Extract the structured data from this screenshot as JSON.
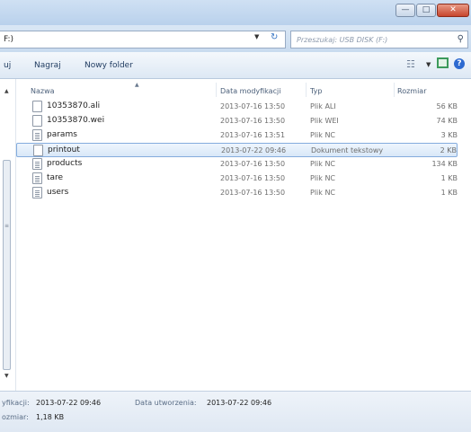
{
  "window": {
    "minimize_glyph": "—",
    "maximize_glyph": "□",
    "close_glyph": "✕"
  },
  "address": {
    "path_fragment": "F:)",
    "search_placeholder": "Przeszukaj: USB DISK (F:)"
  },
  "toolbar": {
    "organize_fragment": "uj",
    "burn_label": "Nagraj",
    "new_folder_label": "Nowy folder"
  },
  "columns": {
    "name": "Nazwa",
    "date": "Data modyfikacji",
    "type": "Typ",
    "size": "Rozmiar"
  },
  "files": [
    {
      "name": "10353870.ali",
      "date": "2013-07-16 13:50",
      "type": "Plik ALI",
      "size": "56 KB",
      "icon": "blank-file-icon"
    },
    {
      "name": "10353870.wei",
      "date": "2013-07-16 13:50",
      "type": "Plik WEI",
      "size": "74 KB",
      "icon": "blank-file-icon"
    },
    {
      "name": "params",
      "date": "2013-07-16 13:51",
      "type": "Plik NC",
      "size": "3 KB",
      "icon": "text-file-icon"
    },
    {
      "name": "printout",
      "date": "2013-07-22 09:46",
      "type": "Dokument tekstowy",
      "size": "2 KB",
      "icon": "blank-file-icon",
      "selected": true
    },
    {
      "name": "products",
      "date": "2013-07-16 13:50",
      "type": "Plik NC",
      "size": "134 KB",
      "icon": "text-file-icon"
    },
    {
      "name": "tare",
      "date": "2013-07-16 13:50",
      "type": "Plik NC",
      "size": "1 KB",
      "icon": "text-file-icon"
    },
    {
      "name": "users",
      "date": "2013-07-16 13:50",
      "type": "Plik NC",
      "size": "1 KB",
      "icon": "text-file-icon"
    }
  ],
  "details": {
    "modified_label": "yfikacji:",
    "modified_value": "2013-07-22 09:46",
    "created_label": "Data utworzenia:",
    "created_value": "2013-07-22 09:46",
    "size_label": "ozmiar:",
    "size_value": "1,18 KB"
  },
  "colors": {
    "selection_border": "#84acdd",
    "titlebar": "#c3d8ef",
    "close_button": "#c7452d"
  }
}
